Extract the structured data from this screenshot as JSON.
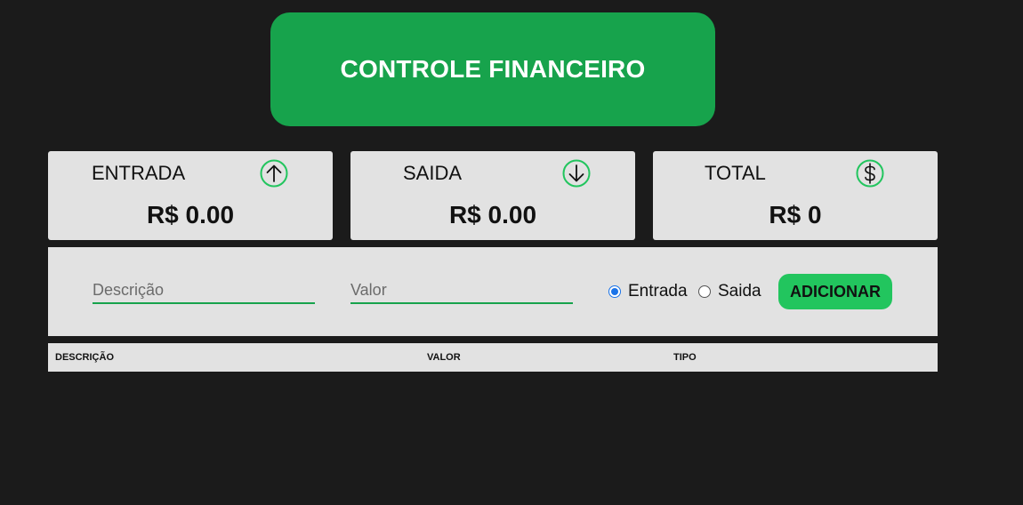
{
  "header": {
    "title": "CONTROLE FINANCEIRO"
  },
  "cards": {
    "entrada": {
      "label": "ENTRADA",
      "amount": "R$ 0.00",
      "icon": "arrow-up-circle-icon"
    },
    "saida": {
      "label": "SAIDA",
      "amount": "R$ 0.00",
      "icon": "arrow-down-circle-icon"
    },
    "total": {
      "label": "TOTAL",
      "amount": "R$ 0",
      "icon": "dollar-circle-icon"
    }
  },
  "form": {
    "description_placeholder": "Descrição",
    "description_value": "",
    "value_placeholder": "Valor",
    "value_value": "",
    "type_options": [
      "Entrada",
      "Saida"
    ],
    "selected_type": "Entrada",
    "add_label": "ADICIONAR"
  },
  "table": {
    "columns": [
      "DESCRIÇÃO",
      "VALOR",
      "TIPO"
    ],
    "rows": []
  },
  "colors": {
    "background": "#1b1b1b",
    "brand_green": "#17a34c",
    "button_green": "#22c55e",
    "icon_green": "#22c55e",
    "panel": "#e2e2e2",
    "radio_selected": "#1a73e8"
  }
}
